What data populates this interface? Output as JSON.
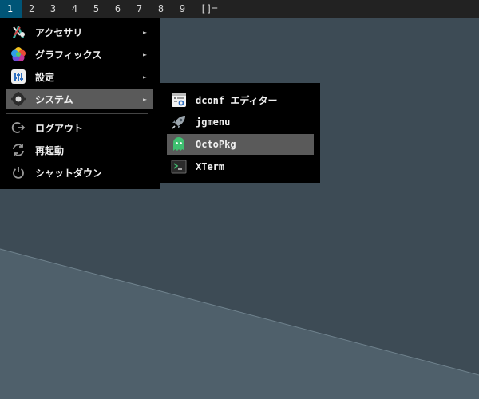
{
  "topbar": {
    "tags": [
      "1",
      "2",
      "3",
      "4",
      "5",
      "6",
      "7",
      "8",
      "9"
    ],
    "active_tag": "1",
    "layout_symbol": "[]="
  },
  "main_menu": {
    "items": [
      {
        "label": "アクセサリ",
        "icon": "accessories-icon",
        "has_submenu": true
      },
      {
        "label": "グラフィックス",
        "icon": "graphics-icon",
        "has_submenu": true
      },
      {
        "label": "設定",
        "icon": "settings-icon",
        "has_submenu": true
      },
      {
        "label": "システム",
        "icon": "system-icon",
        "has_submenu": true,
        "selected": true
      }
    ],
    "session_items": [
      {
        "label": "ログアウト",
        "icon": "logout-icon"
      },
      {
        "label": "再起動",
        "icon": "restart-icon"
      },
      {
        "label": "シャットダウン",
        "icon": "shutdown-icon"
      }
    ],
    "submenu_arrow": "►"
  },
  "system_submenu": {
    "items": [
      {
        "label": "dconf エディター",
        "icon": "dconf-editor-icon"
      },
      {
        "label": "jgmenu",
        "icon": "rocket-icon"
      },
      {
        "label": "OctoPkg",
        "icon": "octopkg-ghost-icon",
        "selected": true
      },
      {
        "label": "XTerm",
        "icon": "terminal-icon"
      }
    ]
  },
  "colors": {
    "topbar_bg": "#222222",
    "active_tag_bg": "#005577",
    "menu_bg": "#000000",
    "selection_bg": "#5a5a5a",
    "desktop_bg": "#3c4a54"
  }
}
